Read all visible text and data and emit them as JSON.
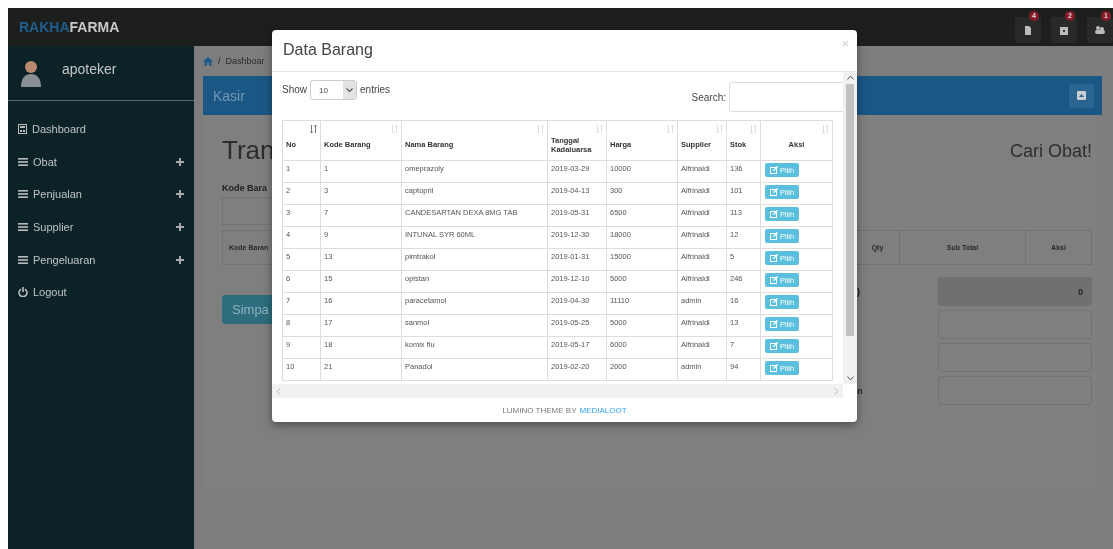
{
  "topbar": {
    "brand_accent": "RAKHA",
    "brand_rest": "FARMA",
    "notifications": [
      {
        "kind": "file",
        "badge": "4"
      },
      {
        "kind": "calendar",
        "badge": "2"
      },
      {
        "kind": "users",
        "badge": "1"
      }
    ]
  },
  "sidebar": {
    "user": "apoteker",
    "items": [
      {
        "kind": "dashboard",
        "label": "Dashboard",
        "expandable": false
      },
      {
        "kind": "list",
        "label": "Obat",
        "expandable": true
      },
      {
        "kind": "list",
        "label": "Penjualan",
        "expandable": true
      },
      {
        "kind": "list",
        "label": "Supplier",
        "expandable": true
      },
      {
        "kind": "list",
        "label": "Pengeluaran",
        "expandable": true
      },
      {
        "kind": "logout",
        "label": "Logout",
        "expandable": false
      }
    ]
  },
  "breadcrumb_separator": "/",
  "breadcrumb": "Dashboar",
  "panel": {
    "title": "Kasir"
  },
  "page": {
    "title": "Tran",
    "search_title": "Cari Obat!",
    "code_label": "Kode Bara",
    "table_first_header": "Kode Baran",
    "table_headers": [
      "Qty",
      "Sub Total",
      "Aksi"
    ],
    "save_button": "Simpa",
    "summary": [
      {
        "label": ")",
        "value": "0",
        "readonly": true
      },
      {
        "readonly": false
      },
      {
        "readonly": false
      },
      {
        "label": "n",
        "readonly": false
      }
    ]
  },
  "modal": {
    "title": "Data Barang",
    "close": "×",
    "show_label": "Show",
    "page_size": "10",
    "entries_label": "entries",
    "search_label": "Search:",
    "columns": [
      {
        "label": "No",
        "sorted": true
      },
      {
        "label": "Kode Barang",
        "sorted": false
      },
      {
        "label": "Nama Barang",
        "sorted": false
      },
      {
        "label": "Tanggal Kadaluarsa",
        "sorted": false
      },
      {
        "label": "Harga",
        "sorted": false
      },
      {
        "label": "Supplier",
        "sorted": false
      },
      {
        "label": "Stok",
        "sorted": false
      },
      {
        "label": "Aksi",
        "sorted": false
      }
    ],
    "rows": [
      {
        "cells": [
          "1",
          "1",
          "omeprazoly",
          "2019-03-29",
          "10000",
          "Alfrinaldi",
          "136"
        ],
        "action": "Pilih"
      },
      {
        "cells": [
          "2",
          "3",
          "captopril",
          "2019-04-13",
          "300",
          "Alfrinaldi",
          "101"
        ],
        "action": "Pilih"
      },
      {
        "cells": [
          "3",
          "7",
          "CANDESARTAN DEXA 8MG TAB",
          "2019-05-31",
          "6500",
          "Alfrinaldi",
          "113"
        ],
        "action": "Pilih"
      },
      {
        "cells": [
          "4",
          "9",
          "INTUNAL SYR 60ML",
          "2019-12-30",
          "18000",
          "Alfrinaldi",
          "12"
        ],
        "action": "Pilih"
      },
      {
        "cells": [
          "5",
          "13",
          "pimtrakol",
          "2019-01-31",
          "15000",
          "Alfrinaldi",
          "5"
        ],
        "action": "Pilih"
      },
      {
        "cells": [
          "6",
          "15",
          "opistan",
          "2019-12-10",
          "5000",
          "Alfrinaldi",
          "246"
        ],
        "action": "Pilih"
      },
      {
        "cells": [
          "7",
          "16",
          "paracetamol",
          "2019-04-30",
          "11110",
          "admin",
          "16"
        ],
        "action": "Pilih"
      },
      {
        "cells": [
          "8",
          "17",
          "sanmol",
          "2019-05-25",
          "5000",
          "Alfrinaldi",
          "13"
        ],
        "action": "Pilih"
      },
      {
        "cells": [
          "9",
          "18",
          "komix flu",
          "2019-05-17",
          "6000",
          "Alfrinaldi",
          "7"
        ],
        "action": "Pilih"
      },
      {
        "cells": [
          "10",
          "21",
          "Panadol",
          "2019-02-20",
          "2000",
          "admin",
          "94"
        ],
        "action": "Pilih"
      }
    ],
    "footer_text": "LUMINO THEME BY",
    "footer_link": "MEDIALOOT"
  }
}
